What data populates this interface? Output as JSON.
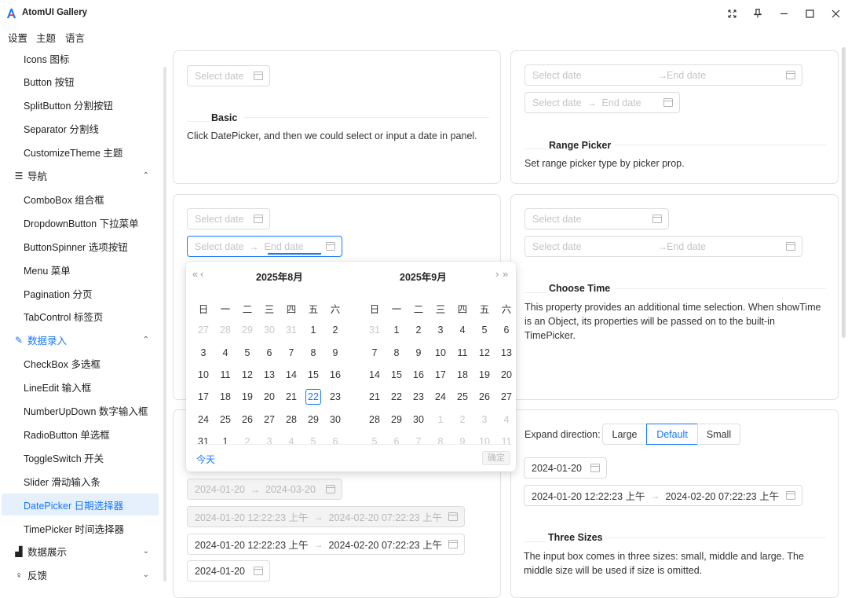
{
  "app": {
    "title": "AtomUI Gallery",
    "logo_color": "#1677ff"
  },
  "menu": {
    "settings": "设置",
    "theme": "主题",
    "language": "语言"
  },
  "sidebar": {
    "items": [
      {
        "label": "Icons 图标"
      },
      {
        "label": "Button 按钮"
      },
      {
        "label": "SplitButton 分割按钮"
      },
      {
        "label": "Separator 分割线"
      },
      {
        "label": "CustomizeTheme 主题"
      },
      {
        "label": "导航",
        "group": true,
        "icon": "menu-lines-icon",
        "chevron": "up"
      },
      {
        "label": "ComboBox 组合框"
      },
      {
        "label": "DropdownButton 下拉菜单"
      },
      {
        "label": "ButtonSpinner 选项按钮"
      },
      {
        "label": "Menu 菜单"
      },
      {
        "label": "Pagination 分页"
      },
      {
        "label": "TabControl 标签页"
      },
      {
        "label": "数据录入",
        "group": true,
        "icon": "edit-icon",
        "chevron": "up",
        "active": true
      },
      {
        "label": "CheckBox 多选框"
      },
      {
        "label": "LineEdit 输入框"
      },
      {
        "label": "NumberUpDown 数字输入框"
      },
      {
        "label": "RadioButton 单选框"
      },
      {
        "label": "ToggleSwitch 开关"
      },
      {
        "label": "Slider 滑动输入条"
      },
      {
        "label": "DatePicker 日期选择器",
        "selected": true
      },
      {
        "label": "TimePicker 时间选择器"
      },
      {
        "label": "数据展示",
        "group": true,
        "icon": "chart-icon",
        "chevron": "down"
      },
      {
        "label": "反馈",
        "group": true,
        "icon": "user-feedback-icon",
        "chevron": "down"
      }
    ]
  },
  "pickers": {
    "placeholder": "Select date",
    "start_placeholder": "Select date",
    "end_placeholder": "End date",
    "arrow": "→",
    "date_value": "2024-01-20",
    "range_start": "2024-01-20",
    "range_end": "2024-03-20",
    "dt_start": "2024-01-20 12:22:23 上午",
    "dt_end": "2024-02-20 07:22:23 上午",
    "dt_end2": "2024-02-20 07:22:23 上午"
  },
  "basic": {
    "title": "Basic",
    "desc": "Click DatePicker, and then we could select or input a date in panel."
  },
  "range": {
    "title": "Range Picker",
    "desc": "Set range picker type by picker prop."
  },
  "choose_time": {
    "title": "Choose Time",
    "desc": "This property provides an additional time selection. When showTime is an Object, its properties will be passed on to the built-in TimePicker."
  },
  "sizes": {
    "expand_label": "Expand direction:",
    "options": [
      "Large",
      "Default",
      "Small"
    ],
    "selected": "Default",
    "title": "Three Sizes",
    "desc": "The input box comes in three sizes: small, middle and large. The middle size will be used if size is omitted."
  },
  "calendar": {
    "left_title": "2025年8月",
    "right_title": "2025年9月",
    "prev_year": "«",
    "prev_month": "‹",
    "next_month": "›",
    "next_year": "»",
    "weekdays": [
      "日",
      "一",
      "二",
      "三",
      "四",
      "五",
      "六"
    ],
    "left_days": [
      "27",
      "28",
      "29",
      "30",
      "31",
      "1",
      "2",
      "3",
      "4",
      "5",
      "6",
      "7",
      "8",
      "9",
      "10",
      "11",
      "12",
      "13",
      "14",
      "15",
      "16",
      "17",
      "18",
      "19",
      "20",
      "21",
      "22",
      "23",
      "24",
      "25",
      "26",
      "27",
      "28",
      "29",
      "30",
      "31",
      "1",
      "2",
      "3",
      "4",
      "5",
      "6"
    ],
    "left_other": [
      0,
      1,
      2,
      3,
      4,
      37,
      38,
      39,
      40,
      41
    ],
    "right_days": [
      "31",
      "1",
      "2",
      "3",
      "4",
      "5",
      "6",
      "7",
      "8",
      "9",
      "10",
      "11",
      "12",
      "13",
      "14",
      "15",
      "16",
      "17",
      "18",
      "19",
      "20",
      "21",
      "22",
      "23",
      "24",
      "25",
      "26",
      "27",
      "28",
      "29",
      "30",
      "1",
      "2",
      "3",
      "4",
      "5",
      "6",
      "7",
      "8",
      "9",
      "10",
      "11"
    ],
    "right_other": [
      0,
      31,
      32,
      33,
      34,
      35,
      36,
      37,
      38,
      39,
      40,
      41
    ],
    "today_index_left": 26,
    "today_btn": "今天",
    "ok_btn": "确定"
  }
}
